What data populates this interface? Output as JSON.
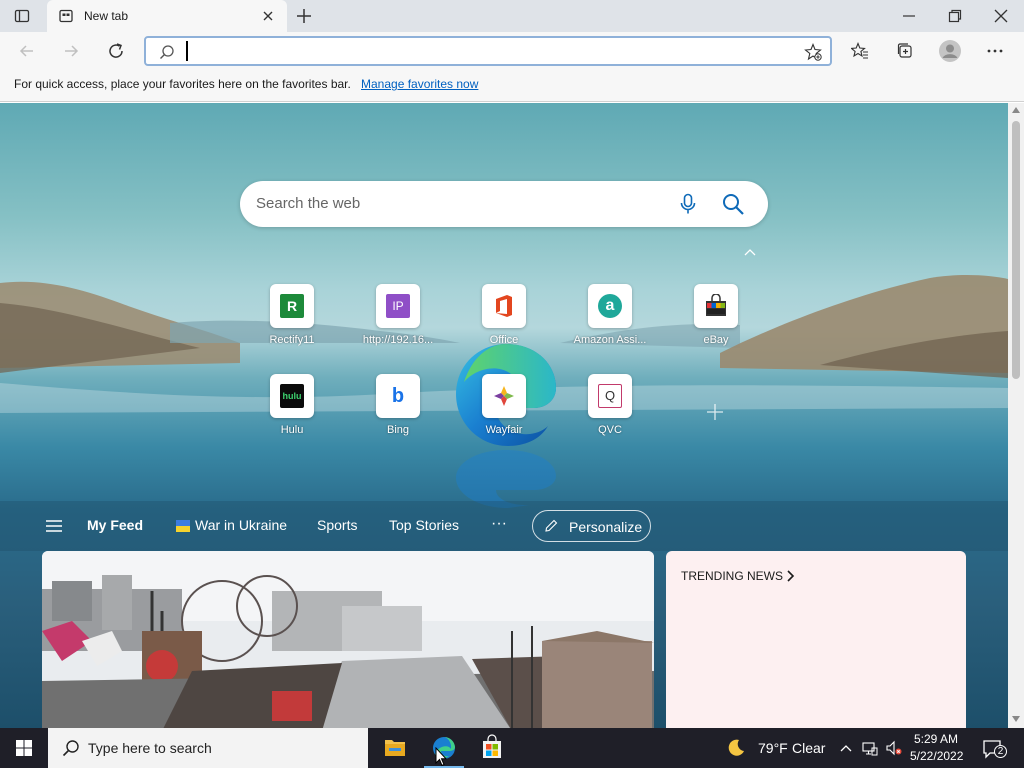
{
  "browser": {
    "tab_title": "New tab",
    "address_value": "",
    "favorites_bar_text": "For quick access, place your favorites here on the favorites bar.",
    "favorites_bar_link": "Manage favorites now"
  },
  "newtab": {
    "search_placeholder": "Search the web",
    "quick_links": [
      {
        "label": "Rectify11",
        "icon": "R"
      },
      {
        "label": "http://192.16...",
        "icon": "IP"
      },
      {
        "label": "Office",
        "icon": "office-icon"
      },
      {
        "label": "Amazon Assi...",
        "icon": "a"
      },
      {
        "label": "eBay",
        "icon": "ebay-bag-icon"
      },
      {
        "label": "Hulu",
        "icon": "hulu"
      },
      {
        "label": "Bing",
        "icon": "b"
      },
      {
        "label": "Wayfair",
        "icon": "wayfair-icon"
      },
      {
        "label": "QVC",
        "icon": "Q"
      }
    ],
    "feed_nav": {
      "my_feed": "My Feed",
      "war_in_ukraine": "War in Ukraine",
      "sports": "Sports",
      "top_stories": "Top Stories",
      "more": "···",
      "personalize": "Personalize"
    },
    "trending": {
      "title": "TRENDING NEWS"
    }
  },
  "taskbar": {
    "search_placeholder": "Type here to search",
    "weather_temp": "79°F",
    "weather_cond": "Clear",
    "time": "5:29 AM",
    "date": "5/22/2022",
    "notification_count": "2"
  },
  "colors": {
    "accent": "#0078d4",
    "link": "#0060c0",
    "taskbar": "#1f1f28"
  }
}
